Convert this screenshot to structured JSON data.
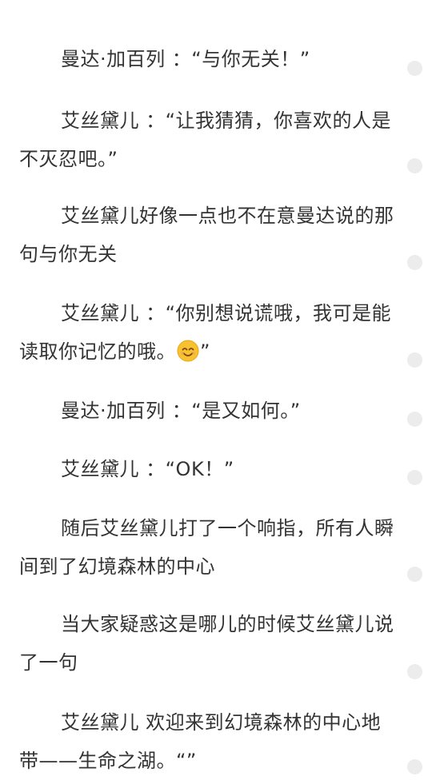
{
  "paragraphs": [
    {
      "text": "曼达·加百列 ：“与你无关！”"
    },
    {
      "text": "艾丝黛儿 ：“让我猜猜，你喜欢的人是不灭忍吧。”"
    },
    {
      "text": "艾丝黛儿好像一点也不在意曼达说的那句与你无关"
    },
    {
      "text_before": "艾丝黛儿 ：“你别想说谎哦，我可是能读取你记忆的哦。",
      "emoji": "smiling-face-emoji",
      "text_after": "”"
    },
    {
      "text": "曼达·加百列 ：“是又如何。”"
    },
    {
      "text": "艾丝黛儿 ：“OK！”"
    },
    {
      "text": "随后艾丝黛儿打了一个响指，所有人瞬间到了幻境森林的中心"
    },
    {
      "text": "当大家疑惑这是哪儿的时候艾丝黛儿说了一句"
    },
    {
      "text": "艾丝黛儿 欢迎来到幻境森林的中心地带——生命之湖。“”"
    }
  ],
  "colors": {
    "text": "#333333",
    "background": "#ffffff",
    "comment_dot": "#ececec",
    "emoji_face": "#f8c130"
  }
}
